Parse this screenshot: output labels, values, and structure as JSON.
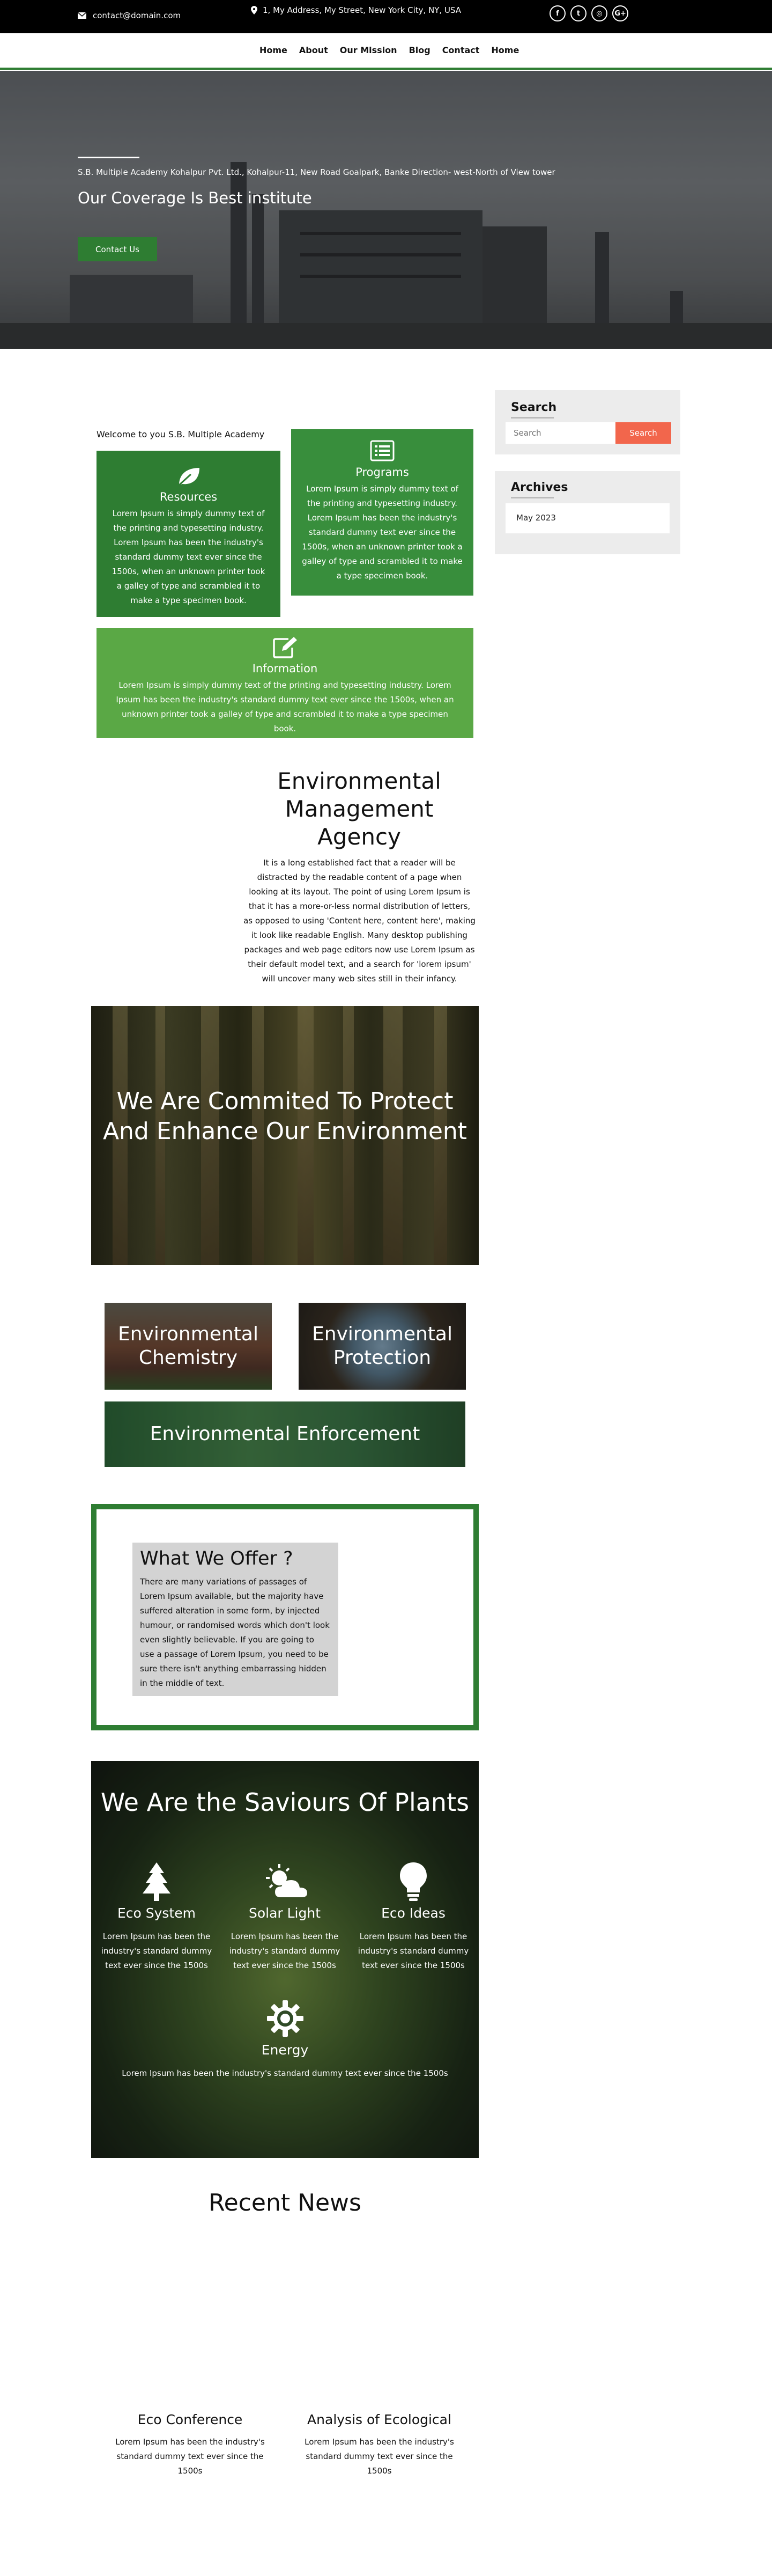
{
  "topbar": {
    "email": "contact@domain.com",
    "address": "1, My Address, My Street, New York City, NY, USA",
    "socials": [
      {
        "icon": "facebook-icon",
        "glyph": "f"
      },
      {
        "icon": "twitter-icon",
        "glyph": "t"
      },
      {
        "icon": "instagram-icon",
        "glyph": "◎"
      },
      {
        "icon": "google-plus-icon",
        "glyph": "G+"
      }
    ]
  },
  "nav": {
    "items": [
      "Home",
      "About",
      "Our Mission",
      "Blog",
      "Contact",
      "Home"
    ]
  },
  "hero": {
    "subtitle": "S.B. Multiple Academy Kohalpur Pvt. Ltd., Kohalpur-11, New Road Goalpark, Banke Direction- west-North of View tower",
    "title": "Our Coverage Is Best institute",
    "button": "Contact Us"
  },
  "sidebar": {
    "search": {
      "title": "Search",
      "placeholder": "Search",
      "button": "Search"
    },
    "archives": {
      "title": "Archives",
      "items": [
        "May 2023"
      ]
    }
  },
  "welcome": "Welcome to you S.B. Multiple Academy",
  "features": [
    {
      "icon": "leaf-icon",
      "title": "Resources",
      "text": "Lorem Ipsum is simply dummy text of the printing and typesetting industry. Lorem Ipsum has been the industry's standard dummy text ever since the 1500s, when an unknown printer took a galley of type and scrambled it to make a type specimen book."
    },
    {
      "icon": "list-icon",
      "title": "Programs",
      "text": "Lorem Ipsum is simply dummy text of the printing and typesetting industry. Lorem Ipsum has been the industry's standard dummy text ever since the 1500s, when an unknown printer took a galley of type and scrambled it to make a type specimen book."
    },
    {
      "icon": "edit-icon",
      "title": "Information",
      "text": "Lorem Ipsum is simply dummy text of the printing and typesetting industry. Lorem Ipsum has been the industry's standard dummy text ever since the 1500s, when an unknown printer took a galley of type and scrambled it to make a type specimen book."
    }
  ],
  "agency": {
    "title": "Environmental Management Agency",
    "text": "It is a long established fact that a reader will be distracted by the readable content of a page when looking at its layout. The point of using Lorem Ipsum is that it has a more-or-less normal distribution of letters, as opposed to using 'Content here, content here', making it look like readable English. Many desktop publishing packages and web page editors now use Lorem Ipsum as their default model text, and a search for 'lorem ipsum' will uncover many web sites still in their infancy."
  },
  "commit": {
    "text": "We Are Commited To Protect And Enhance Our Environment"
  },
  "categories": [
    "Environmental Chemistry",
    "Environmental Protection",
    "Environmental Enforcement"
  ],
  "offer": {
    "title": "What We Offer ?",
    "text": "There are many variations of passages of Lorem Ipsum available, but the majority have suffered alteration in some form, by injected humour, or randomised words which don't look even slightly believable. If you are going to use a passage of Lorem Ipsum, you need to be sure there isn't anything embarrassing hidden in the middle of text."
  },
  "saviours": {
    "title": "We Are the Saviours Of Plants",
    "items": [
      {
        "icon": "tree-icon",
        "title": "Eco System",
        "text": "Lorem Ipsum has been the industry's standard dummy text ever since the 1500s"
      },
      {
        "icon": "sun-cloud-icon",
        "title": "Solar Light",
        "text": "Lorem Ipsum has been the industry's standard dummy text ever since the 1500s"
      },
      {
        "icon": "lightbulb-icon",
        "title": "Eco Ideas",
        "text": "Lorem Ipsum has been the industry's standard dummy text ever since the 1500s"
      }
    ],
    "energy": {
      "icon": "gear-icon",
      "title": "Energy",
      "text": "Lorem Ipsum has been the industry's standard dummy text ever since the 1500s"
    }
  },
  "news": {
    "title": "Recent News",
    "items": [
      {
        "title": "Eco Conference",
        "text": "Lorem Ipsum has been the industry's standard dummy text ever since the 1500s"
      },
      {
        "title": "Analysis of Ecological",
        "text": "Lorem Ipsum has been the industry's standard dummy text ever since the 1500s"
      }
    ]
  },
  "colors": {
    "primary_green": "#2e7d32",
    "mid_green": "#388e3c",
    "light_green": "#5aa845",
    "search_button": "#f2664c"
  }
}
